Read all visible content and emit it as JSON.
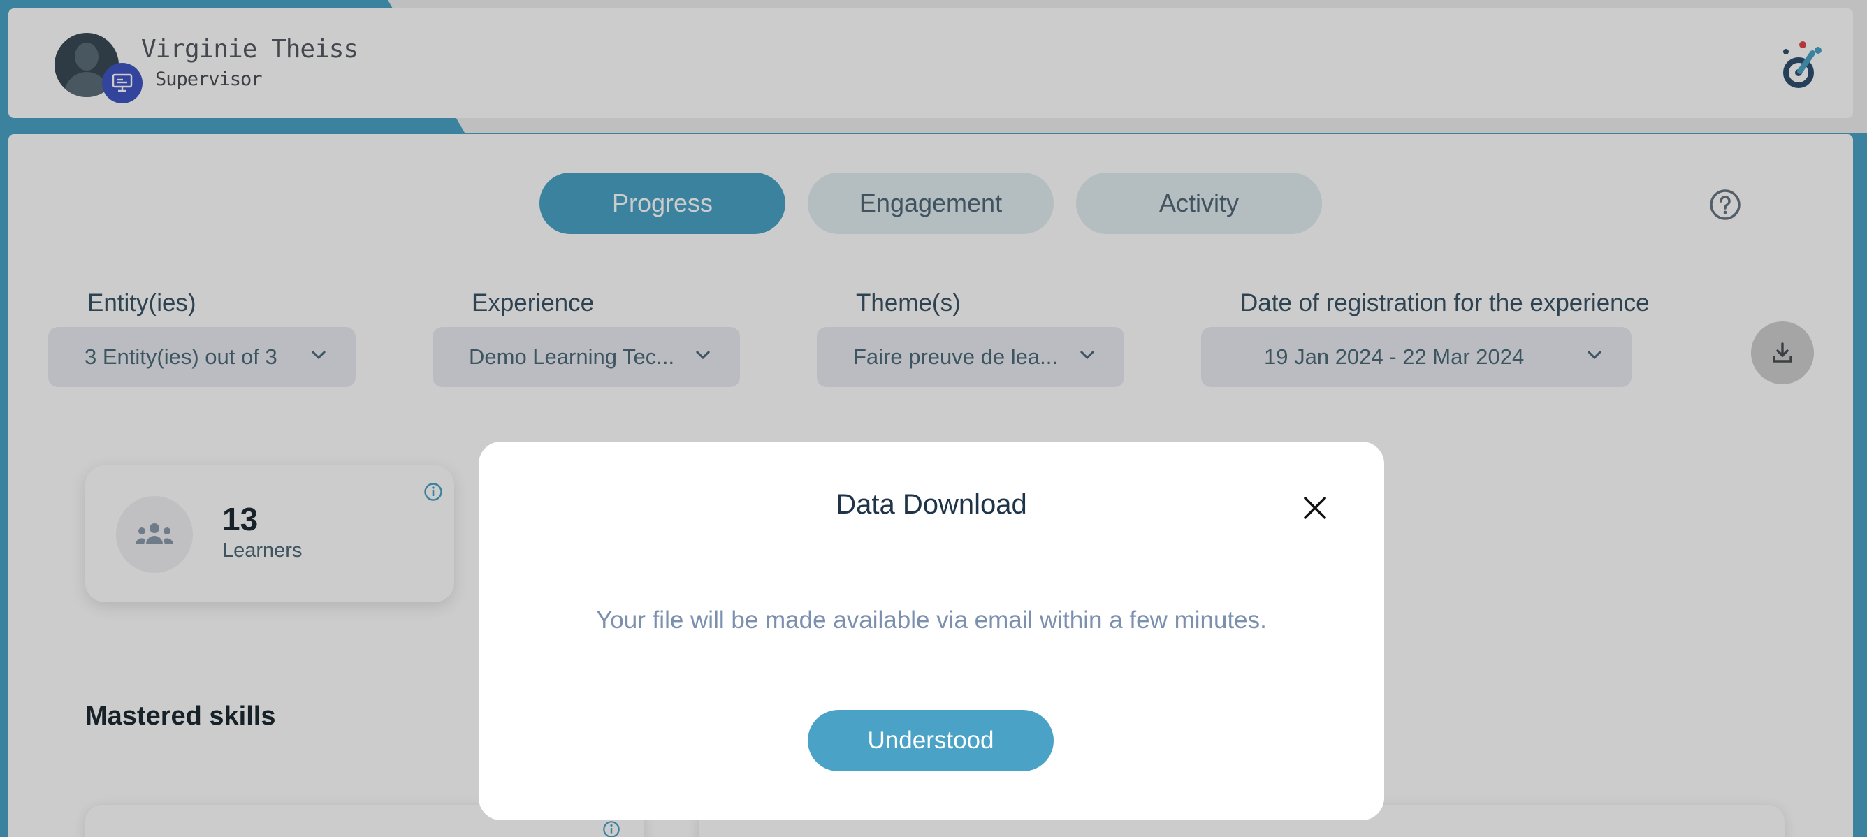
{
  "user": {
    "name": "Virginie Theiss",
    "role": "Supervisor"
  },
  "tabs": [
    {
      "label": "Progress",
      "active": true
    },
    {
      "label": "Engagement",
      "active": false
    },
    {
      "label": "Activity",
      "active": false
    }
  ],
  "filters": {
    "entities": {
      "label": "Entity(ies)",
      "value": "3 Entity(ies) out of 3"
    },
    "experience": {
      "label": "Experience",
      "value": "Demo Learning Tec..."
    },
    "themes": {
      "label": "Theme(s)",
      "value": "Faire preuve de lea..."
    },
    "date": {
      "label": "Date of registration for the experience",
      "value": "19 Jan 2024 - 22 Mar 2024"
    }
  },
  "kpi": {
    "value": "13",
    "label": "Learners"
  },
  "sections": {
    "mastered_skills": "Mastered skills"
  },
  "modal": {
    "title": "Data Download",
    "message": "Your file will be made available via email within a few minutes.",
    "button_label": "Understood"
  },
  "colors": {
    "accent": "#4aa3c6",
    "tab_inactive": "#e2edf1",
    "role_badge": "#3f55c4"
  }
}
